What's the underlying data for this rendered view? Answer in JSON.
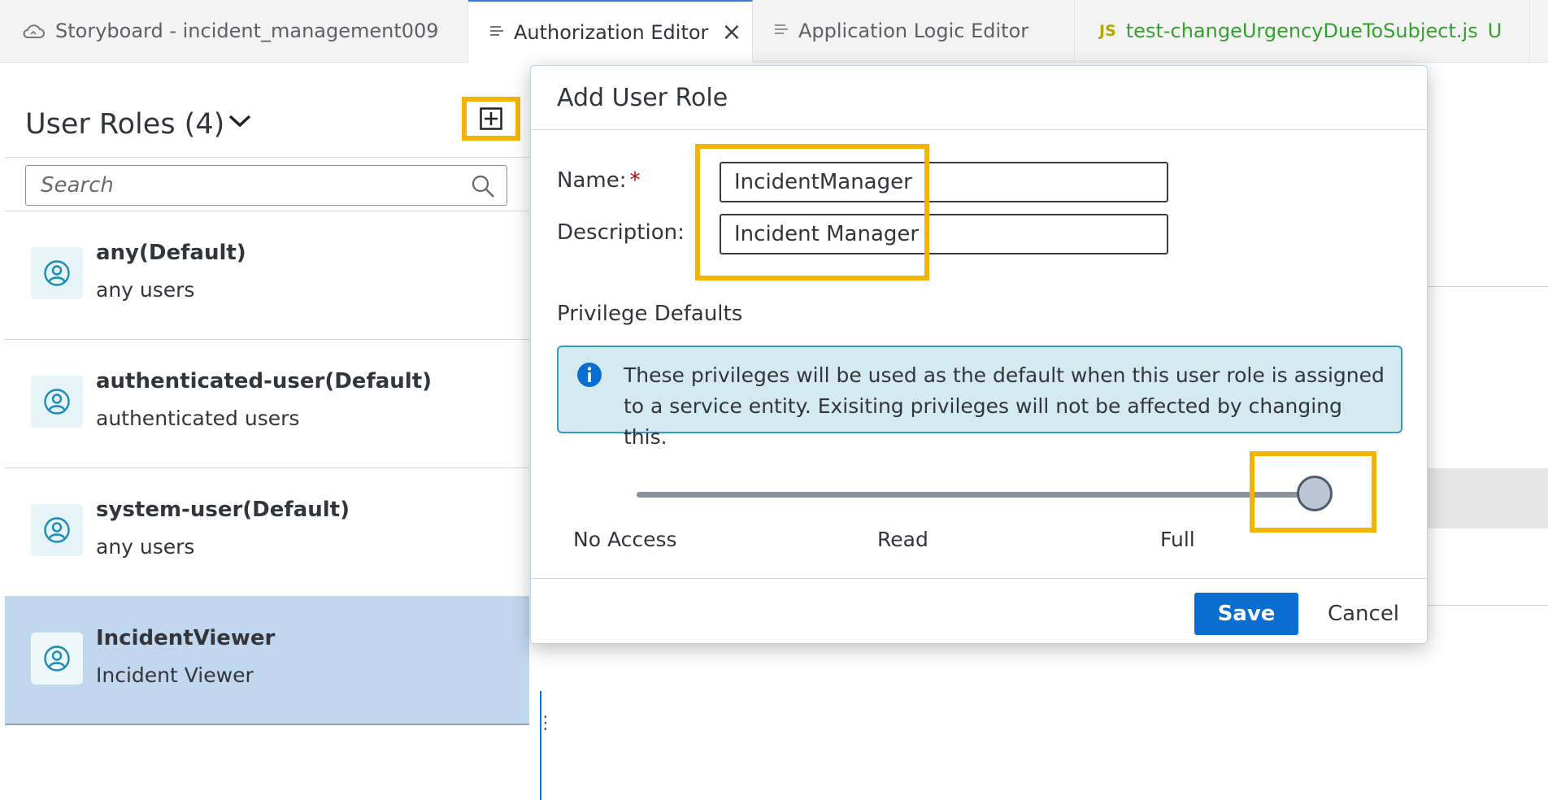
{
  "tabs": [
    {
      "label": "Storyboard - incident_management009",
      "icon": "cloud-icon",
      "active": false
    },
    {
      "label": "Authorization Editor",
      "icon": "document-lines-icon",
      "active": true,
      "close": "×"
    },
    {
      "label": "Application Logic Editor",
      "icon": "document-lines-icon",
      "active": false
    },
    {
      "label": "test-changeUrgencyDueToSubject.js",
      "icon": "js-icon",
      "icon_text": "JS",
      "badge": "U",
      "active": false
    }
  ],
  "sidebar": {
    "title": "User Roles (4)",
    "search_placeholder": "Search",
    "roles": [
      {
        "name": "any(Default)",
        "description": "any users"
      },
      {
        "name": "authenticated-user(Default)",
        "description": "authenticated users"
      },
      {
        "name": "system-user(Default)",
        "description": "any users"
      },
      {
        "name": "IncidentViewer",
        "description": "Incident Viewer",
        "selected": true
      }
    ]
  },
  "dialog": {
    "title": "Add User Role",
    "name_label": "Name:",
    "required_marker": "*",
    "name_value": "IncidentManager",
    "description_label": "Description:",
    "description_value": "Incident Manager",
    "privilege_label": "Privilege Defaults",
    "info_text": "These privileges will be used as the default when this user role is assigned to a service entity. Exisiting privileges will not be affected by changing this.",
    "slider": {
      "levels": [
        "No Access",
        "Read",
        "Full"
      ],
      "selected": "Full"
    },
    "save_label": "Save",
    "cancel_label": "Cancel"
  },
  "colors": {
    "accent": "#0a6ed1",
    "highlight": "#f3b400",
    "selected_row": "#c1d7ee",
    "info_bg": "#d3eaf1"
  }
}
